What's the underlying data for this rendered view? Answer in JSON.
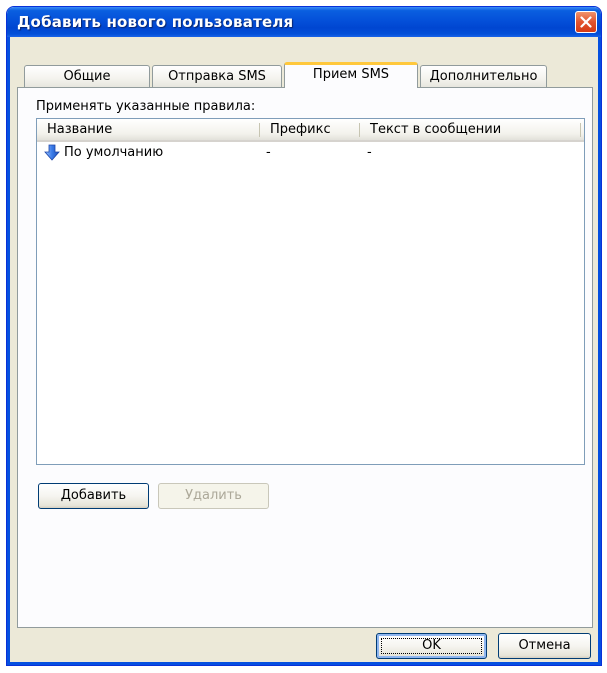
{
  "window": {
    "title": "Добавить нового пользователя"
  },
  "tabs": [
    {
      "label": "Общие"
    },
    {
      "label": "Отправка SMS"
    },
    {
      "label": "Прием SMS",
      "active": true
    },
    {
      "label": "Дополнительно"
    }
  ],
  "panel": {
    "rules_label": "Применять указанные правила:",
    "columns": [
      "Название",
      "Префикс",
      "Текст в сообщении"
    ],
    "rows": [
      {
        "icon": "blue-down-arrow-icon",
        "name": "По умолчанию",
        "prefix": "-",
        "text": "-"
      }
    ],
    "add_button": "Добавить",
    "delete_button": "Удалить"
  },
  "footer": {
    "ok_button": "OK",
    "cancel_button": "Отмена"
  },
  "colors": {
    "titlebar": "#0450d9",
    "active_tab_highlight": "#ffc83c",
    "dialog_background": "#ece9d8"
  }
}
